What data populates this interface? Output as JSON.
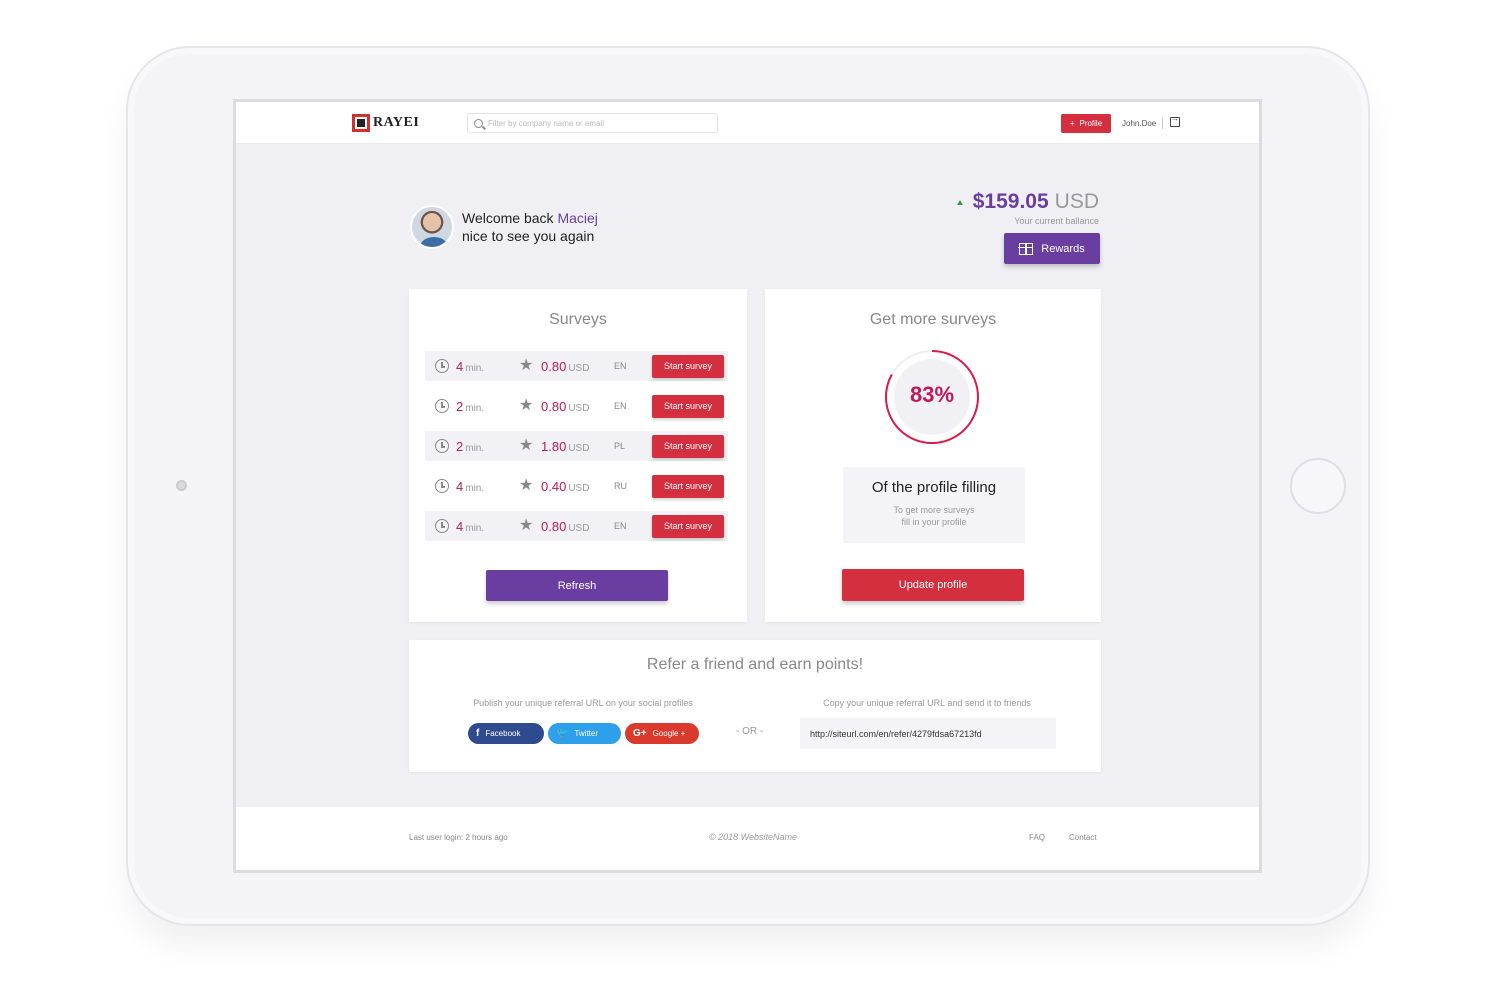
{
  "header": {
    "logo_text": "RAYEI",
    "search_placeholder": "Filter by company name or email",
    "profile_button": "Profile",
    "username": "John.Doe"
  },
  "welcome": {
    "line1_prefix": "Welcome back ",
    "name": "Maciej",
    "line2": "nice to see you again"
  },
  "balance": {
    "amount": "$159.05",
    "currency": "USD",
    "caption": "Your current ballance",
    "rewards_label": "Rewards"
  },
  "surveys": {
    "title": "Surveys",
    "min_unit": "min.",
    "price_unit": "USD",
    "start_label": "Start survey",
    "items": [
      {
        "minutes": "4",
        "price": "0.80",
        "lang": "EN"
      },
      {
        "minutes": "2",
        "price": "0.80",
        "lang": "EN"
      },
      {
        "minutes": "2",
        "price": "1.80",
        "lang": "PL"
      },
      {
        "minutes": "4",
        "price": "0.40",
        "lang": "RU"
      },
      {
        "minutes": "4",
        "price": "0.80",
        "lang": "EN"
      }
    ],
    "refresh_label": "Refresh"
  },
  "more_surveys": {
    "title": "Get more surveys",
    "percent_text": "83%",
    "percent_value": 0.83,
    "box_title": "Of the profile filling",
    "box_sub_line1": "To get more surveys",
    "box_sub_line2": "fill in your profile",
    "update_label": "Update profile"
  },
  "refer": {
    "title": "Refer a friend and earn points!",
    "left_caption": "Publish your unique referral URL on your social profiles",
    "right_caption": "Copy your unique referral URL and send it to friends",
    "facebook": "Facebook",
    "twitter": "Twitter",
    "google": "Google +",
    "or": "- OR -",
    "url": "http://siteurl.com/en/refer/4279fdsa67213fd"
  },
  "footer": {
    "last_login": "Last user login: 2 hours ago",
    "copyright": "© 2018 WebsiteName",
    "faq": "FAQ",
    "contact": "Contact"
  },
  "colors": {
    "accent_purple": "#6a3ea1",
    "accent_red": "#d32f3f",
    "value_pink": "#c2185b"
  }
}
